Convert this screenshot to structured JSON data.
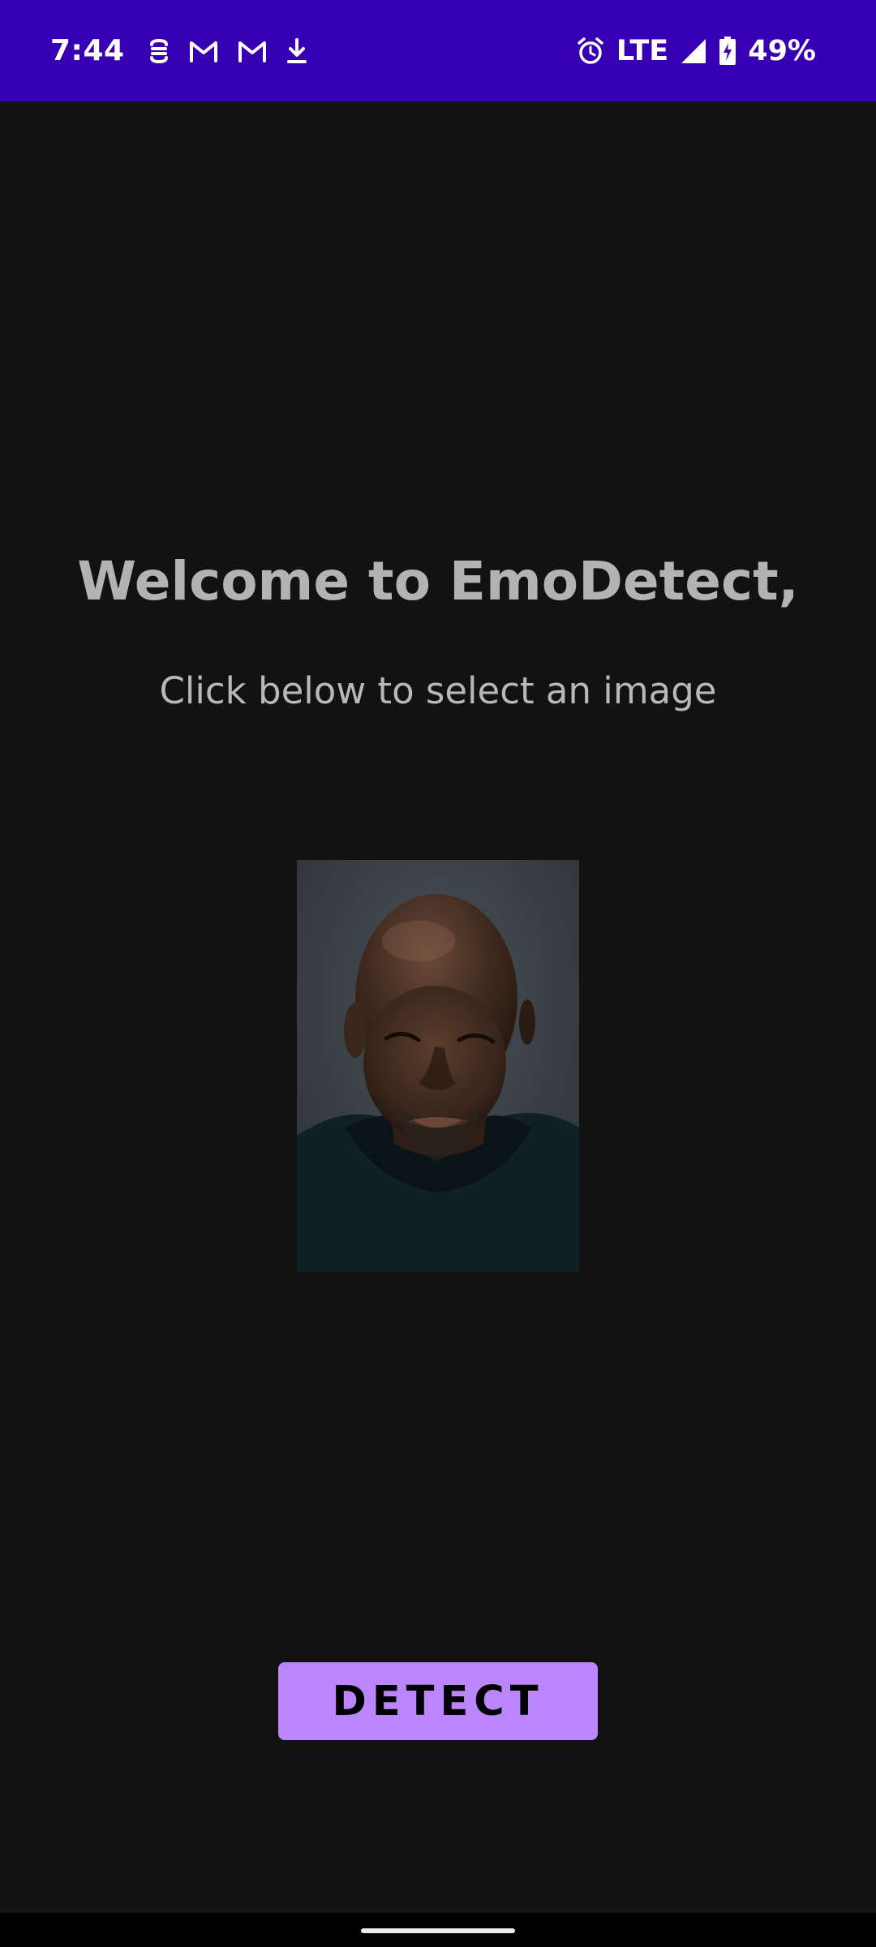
{
  "status_bar": {
    "time": "7:44",
    "network": "LTE",
    "battery": "49%",
    "background_color": "#3700B3",
    "left_icons": [
      "sync-icon",
      "gmail-icon",
      "gmail-icon",
      "download-icon"
    ],
    "right_icons": [
      "alarm-icon",
      "signal-icon",
      "battery-charging-icon"
    ]
  },
  "main": {
    "title": "Welcome to EmoDetect,",
    "subtitle": "Click below to select an image",
    "detect_button_label": "DETECT",
    "accent_color": "#BB86FC",
    "background_color": "#121212"
  }
}
